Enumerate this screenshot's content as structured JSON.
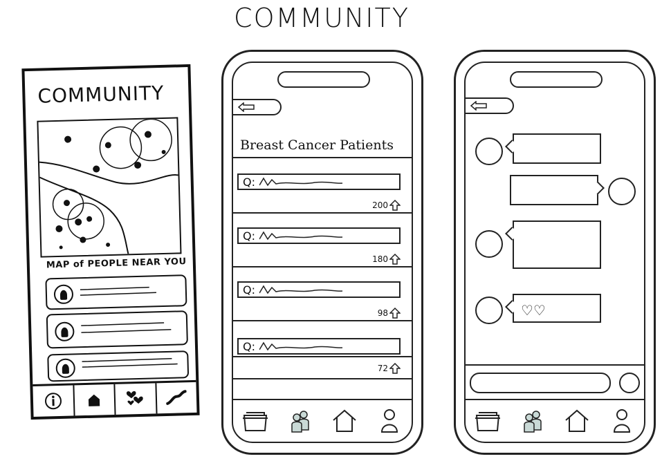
{
  "page": {
    "title": "COMMUNITY"
  },
  "map_screen": {
    "title": "COMMUNITY",
    "map_caption": "MAP of PEOPLE NEAR YOU",
    "people_cards": [
      {
        "icon": "person-avatar-icon"
      },
      {
        "icon": "person-avatar-icon"
      },
      {
        "icon": "person-avatar-icon"
      }
    ],
    "tabs": [
      {
        "icon": "info-icon"
      },
      {
        "icon": "home-icon"
      },
      {
        "icon": "hearts-icon"
      },
      {
        "icon": "trend-icon"
      }
    ]
  },
  "forum_screen": {
    "group_title": "Breast Cancer Patients",
    "questions": [
      {
        "label": "Q:",
        "votes": "200"
      },
      {
        "label": "Q:",
        "votes": "180"
      },
      {
        "label": "Q:",
        "votes": "98"
      },
      {
        "label": "Q:",
        "votes": "72"
      }
    ],
    "tabs": [
      {
        "icon": "folder-icon"
      },
      {
        "icon": "people-icon"
      },
      {
        "icon": "home-icon"
      },
      {
        "icon": "profile-icon"
      }
    ]
  },
  "chat_screen": {
    "messages": [
      {
        "side": "left",
        "content": ""
      },
      {
        "side": "right",
        "content": ""
      },
      {
        "side": "left",
        "content": ""
      },
      {
        "side": "left",
        "content": "♡♡"
      }
    ],
    "tabs": [
      {
        "icon": "folder-icon"
      },
      {
        "icon": "people-icon"
      },
      {
        "icon": "home-icon"
      },
      {
        "icon": "profile-icon"
      }
    ]
  },
  "colors": {
    "ink": "#111111",
    "accent_people": "#c9d9d6"
  }
}
